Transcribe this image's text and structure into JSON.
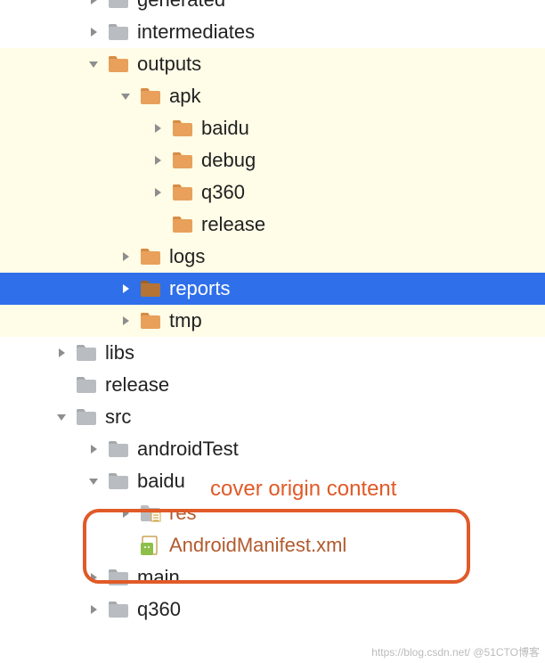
{
  "colors": {
    "folder_orange": "#e8a05a",
    "folder_gray": "#b9bcc0",
    "arrow_gray": "#8e8e8e",
    "arrow_white": "#ffffff",
    "selected_bg": "#2f6fea",
    "highlight_bg": "#fffde7",
    "annotation": "#e05a28"
  },
  "annotation_text": "cover origin content",
  "watermark": "https://blog.csdn.net/ @51CTO博客",
  "tree": [
    {
      "label": "generated",
      "depth": 2,
      "expanded": false,
      "hasArrow": true,
      "iconColor": "gray",
      "highlight": false,
      "selected": false,
      "cutoff": true
    },
    {
      "label": "intermediates",
      "depth": 2,
      "expanded": false,
      "hasArrow": true,
      "iconColor": "gray",
      "highlight": false,
      "selected": false
    },
    {
      "label": "outputs",
      "depth": 2,
      "expanded": true,
      "hasArrow": true,
      "iconColor": "orange",
      "highlight": true,
      "selected": false
    },
    {
      "label": "apk",
      "depth": 3,
      "expanded": true,
      "hasArrow": true,
      "iconColor": "orange",
      "highlight": true,
      "selected": false
    },
    {
      "label": "baidu",
      "depth": 4,
      "expanded": false,
      "hasArrow": true,
      "iconColor": "orange",
      "highlight": true,
      "selected": false
    },
    {
      "label": "debug",
      "depth": 4,
      "expanded": false,
      "hasArrow": true,
      "iconColor": "orange",
      "highlight": true,
      "selected": false
    },
    {
      "label": "q360",
      "depth": 4,
      "expanded": false,
      "hasArrow": true,
      "iconColor": "orange",
      "highlight": true,
      "selected": false
    },
    {
      "label": "release",
      "depth": 4,
      "expanded": false,
      "hasArrow": false,
      "iconColor": "orange",
      "highlight": true,
      "selected": false
    },
    {
      "label": "logs",
      "depth": 3,
      "expanded": false,
      "hasArrow": true,
      "iconColor": "orange",
      "highlight": true,
      "selected": false
    },
    {
      "label": "reports",
      "depth": 3,
      "expanded": false,
      "hasArrow": true,
      "iconColor": "orange",
      "highlight": false,
      "selected": true
    },
    {
      "label": "tmp",
      "depth": 3,
      "expanded": false,
      "hasArrow": true,
      "iconColor": "orange",
      "highlight": true,
      "selected": false
    },
    {
      "label": "libs",
      "depth": 1,
      "expanded": false,
      "hasArrow": true,
      "iconColor": "gray",
      "highlight": false,
      "selected": false
    },
    {
      "label": "release",
      "depth": 1,
      "expanded": false,
      "hasArrow": false,
      "iconColor": "gray",
      "highlight": false,
      "selected": false
    },
    {
      "label": "src",
      "depth": 1,
      "expanded": true,
      "hasArrow": true,
      "iconColor": "gray",
      "highlight": false,
      "selected": false
    },
    {
      "label": "androidTest",
      "depth": 2,
      "expanded": false,
      "hasArrow": true,
      "iconColor": "gray",
      "highlight": false,
      "selected": false
    },
    {
      "label": "baidu",
      "depth": 2,
      "expanded": true,
      "hasArrow": true,
      "iconColor": "gray",
      "highlight": false,
      "selected": false
    },
    {
      "label": "res",
      "depth": 3,
      "expanded": false,
      "hasArrow": true,
      "iconColor": "res",
      "highlight": false,
      "selected": false,
      "warn": true
    },
    {
      "label": "AndroidManifest.xml",
      "depth": 3,
      "expanded": false,
      "hasArrow": false,
      "iconColor": "manifest",
      "highlight": false,
      "selected": false,
      "warn": true
    },
    {
      "label": "main",
      "depth": 2,
      "expanded": false,
      "hasArrow": true,
      "iconColor": "gray",
      "highlight": false,
      "selected": false
    },
    {
      "label": "q360",
      "depth": 2,
      "expanded": false,
      "hasArrow": true,
      "iconColor": "gray",
      "highlight": false,
      "selected": false
    }
  ]
}
